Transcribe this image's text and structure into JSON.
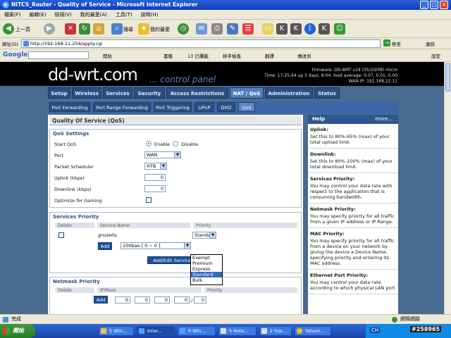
{
  "window": {
    "title": "NITCS_Router - Quality of Service - Microsoft Internet Explorer",
    "menu": [
      "檔案(F)",
      "編輯(E)",
      "檢視(V)",
      "我的最愛(A)",
      "工具(T)",
      "說明(H)"
    ]
  },
  "toolbar": {
    "back": "上一頁",
    "search": "搜尋",
    "favorites": "我的最愛"
  },
  "address": {
    "label": "網址(D)",
    "url": "http://192.168.11.254/apply.cgi",
    "go": "移至",
    "links": "連結"
  },
  "googlebar": {
    "logo": "Google",
    "search_btn": "開始",
    "bookmarks": "書籤",
    "blocked": "13 已攔截",
    "spell": "拼字檢查",
    "translate": "翻譯",
    "send": "傳送到",
    "settings": "設定"
  },
  "router": {
    "logo": "dd-wrt.com",
    "panel": "... control panel",
    "firmware": "Firmware: DD-WRT v24 (05/20/08) micro",
    "time": "Time: 17:25:44 up 5 days, 8:04, load average: 0.07, 0.01, 0.00",
    "wan": "WAN IP: 192.168.22.11",
    "tabs": [
      "Setup",
      "Wireless",
      "Services",
      "Security",
      "Access Restrictions",
      "NAT / QoS",
      "Administration",
      "Status"
    ],
    "subtabs": [
      "Port Forwarding",
      "Port Range Forwarding",
      "Port Triggering",
      "UPnP",
      "DMZ",
      "QoS"
    ]
  },
  "qos": {
    "section_title": "Quality Of Service (QoS)",
    "settings_legend": "QoS Settings",
    "start_qos": "Start QoS",
    "enable": "Enable",
    "disable": "Disable",
    "port": "Port",
    "port_value": "WAN",
    "scheduler": "Packet Scheduler",
    "scheduler_value": "HTB",
    "uplink": "Uplink (kbps)",
    "uplink_value": "0",
    "downlink": "Downlink (kbps)",
    "downlink_value": "0",
    "optimize": "Optimize for Gaming"
  },
  "services": {
    "legend": "Services Priority",
    "col_delete": "Delete",
    "col_service": "Service Name",
    "col_priority": "Priority",
    "row_service": "gnutella",
    "row_priority": "Standard",
    "add": "Add",
    "add_select": "100bao [ 0 ~ 0 ]",
    "edit": "Add/Edit Service",
    "options": [
      "Exempt",
      "Premium",
      "Express",
      "Standard",
      "Bulk"
    ],
    "highlighted": "Standard"
  },
  "netmask": {
    "legend": "Netmask Priority",
    "col_delete": "Delete",
    "col_ip": "IP/Mask",
    "col_priority": "Priority",
    "add": "Add",
    "ip": [
      "0",
      "0",
      "0",
      "0",
      "0"
    ]
  },
  "help": {
    "title": "Help",
    "more": "more...",
    "items": [
      {
        "title": "Uplink:",
        "text": "Set this to 80%-95% (max) of your total upload limit."
      },
      {
        "title": "Downlink:",
        "text": "Set this to 80%-100% (max) of your total download limit."
      },
      {
        "title": "Services Priority:",
        "text": "You may control your data rate with respect to the application that is consuming bandwidth."
      },
      {
        "title": "Netmask Priority:",
        "text": "You may specify priority for all traffic from a given IP address or IP Range."
      },
      {
        "title": "MAC Priority:",
        "text": "You may specify priority for all traffic from a device on your network by giving the device a Device Name, specifying priority and entering its MAC address."
      },
      {
        "title": "Ethernet Port Priority:",
        "text": "You may control your data rate according to which physical LAN port"
      }
    ]
  },
  "statusbar": {
    "left": "完成",
    "right": "網際網路"
  },
  "taskbar": {
    "start": "開始",
    "tasks": [
      "5 Win...",
      "Inter...",
      "6 Win...",
      "5 Note...",
      "2 hos...",
      "Yahoo!..."
    ],
    "lang": "CH",
    "stamp": "#258965"
  }
}
